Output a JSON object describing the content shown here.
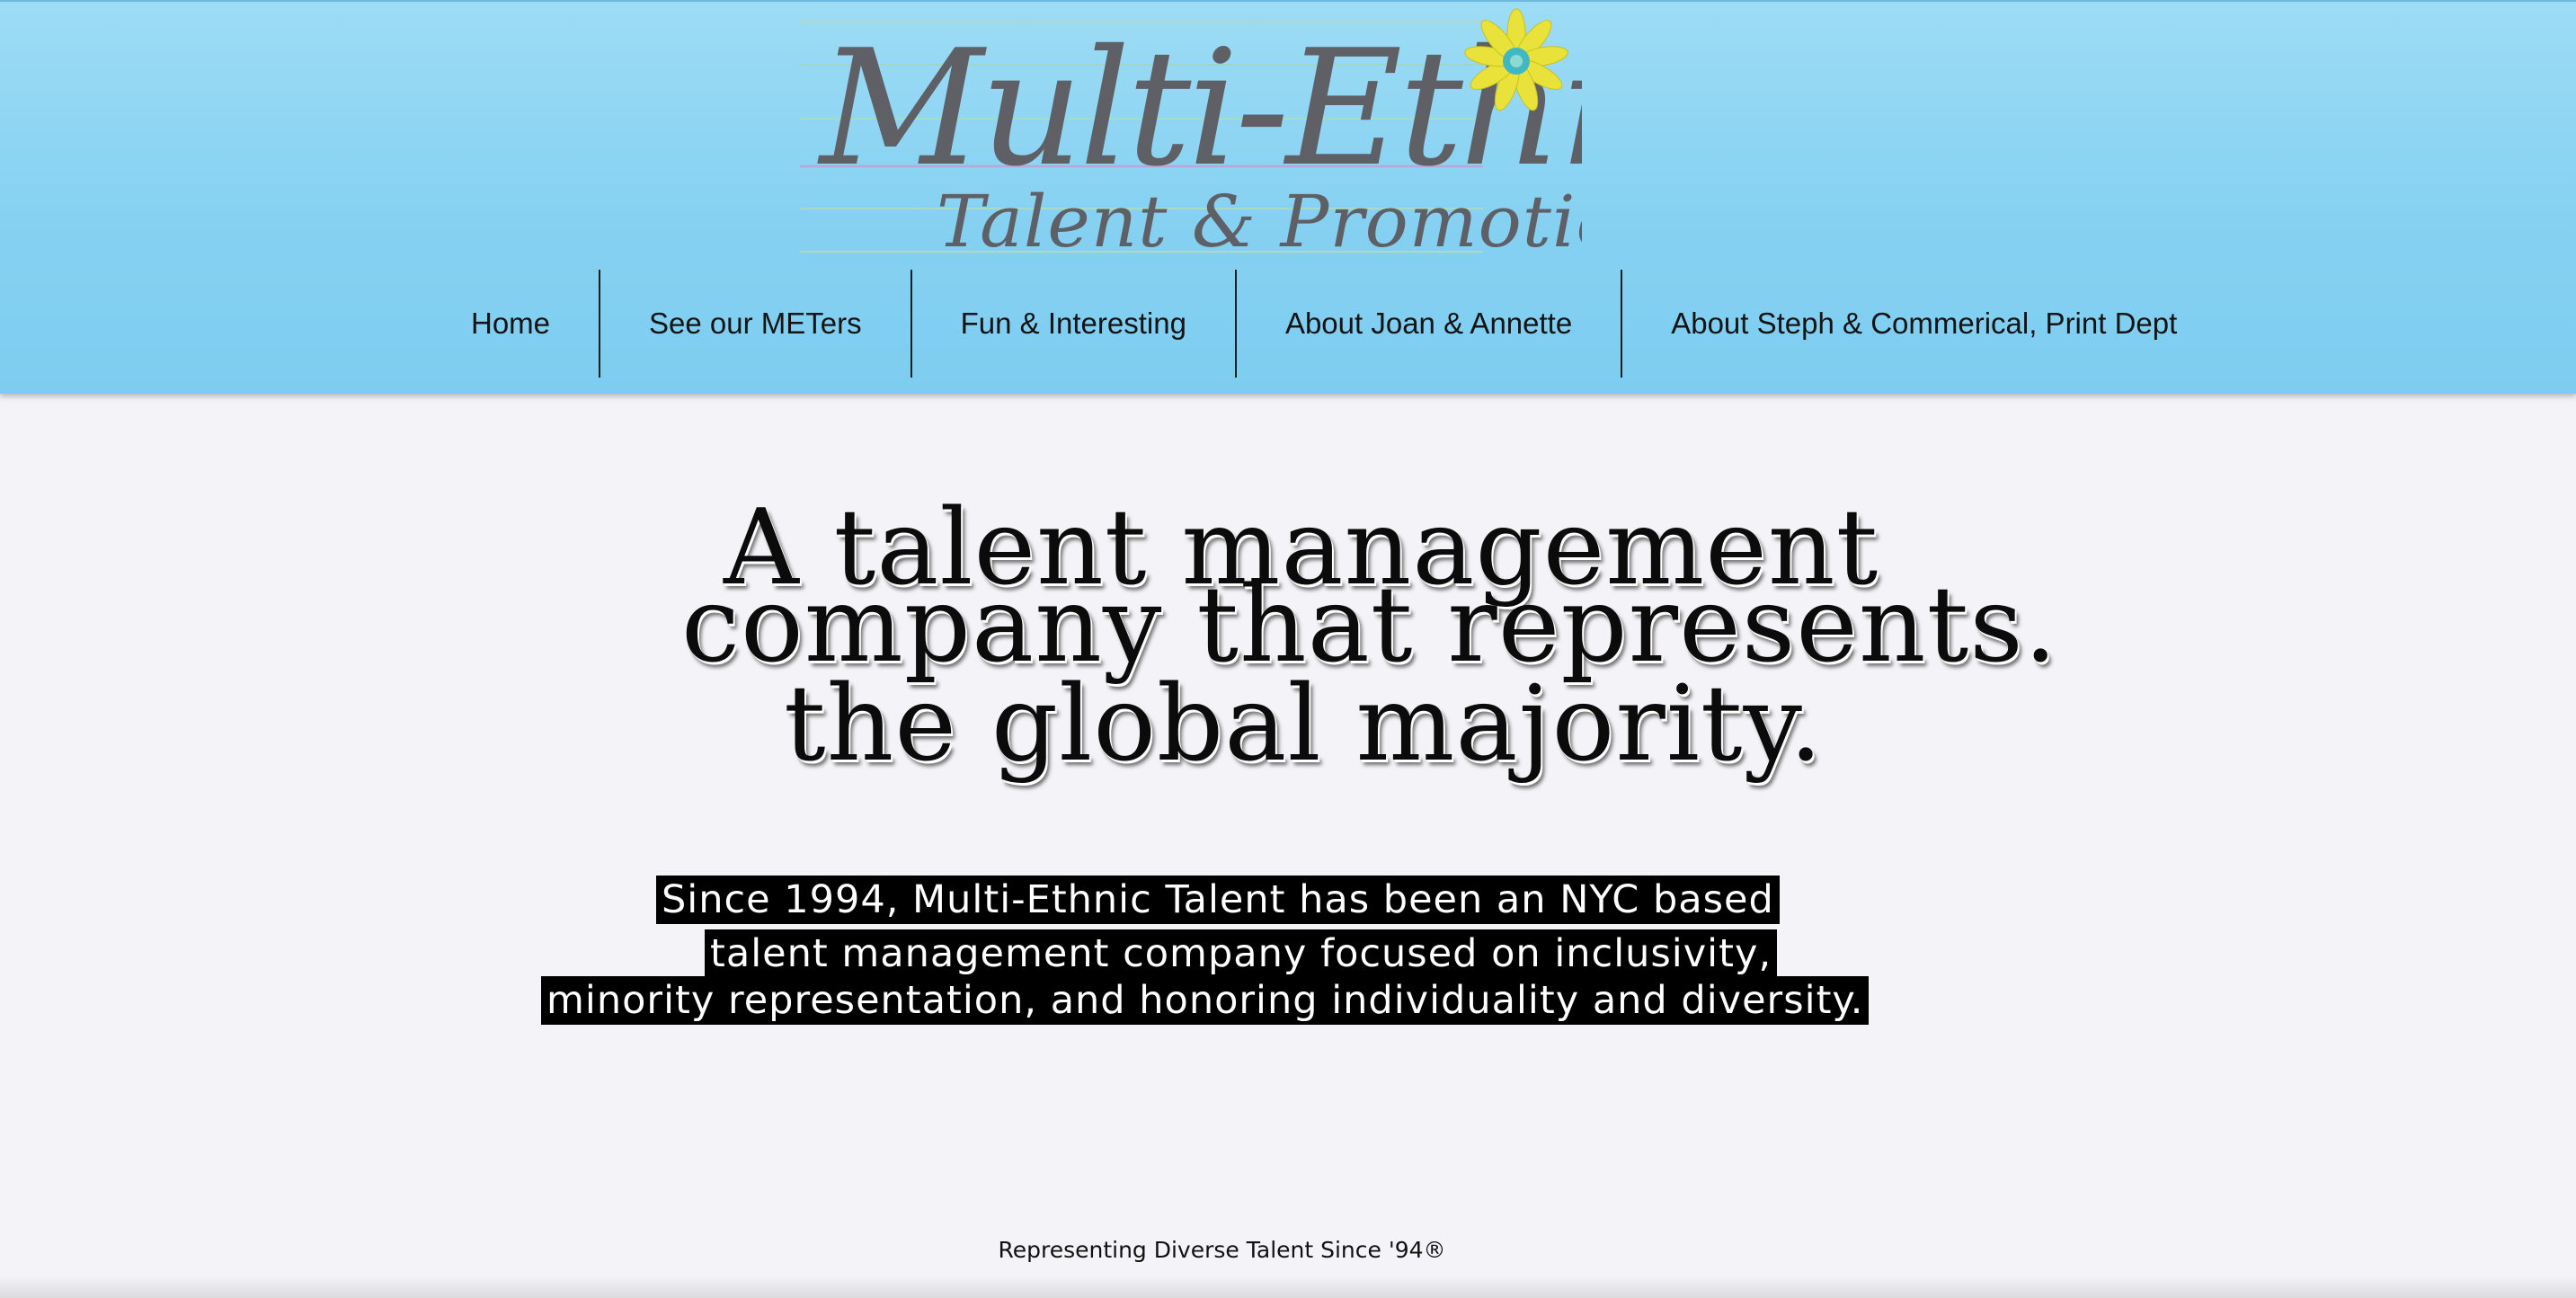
{
  "header": {
    "logo": {
      "title": "Multi-Ethnic",
      "subtitle": "Talent & Promotion",
      "flower_color": "#e8e23a",
      "flower_center_color": "#3fb8c4",
      "text_color": "#5f5f66"
    },
    "nav": [
      {
        "label": "Home"
      },
      {
        "label": "See our METers"
      },
      {
        "label": "Fun & Interesting"
      },
      {
        "label": "About Joan & Annette"
      },
      {
        "label": "About Steph & Commerical, Print Dept"
      }
    ]
  },
  "hero": {
    "lines": [
      "A talent management",
      "company that represents.",
      "the global majority."
    ]
  },
  "description": {
    "lines": [
      "Since 1994, Multi-Ethnic Talent has been an NYC based ",
      "talent management company focused on inclusivity,",
      "minority representation, and honoring individuality and diversity."
    ]
  },
  "footer": {
    "tagline": "Representing Diverse Talent Since '94®"
  },
  "colors": {
    "header_top": "#9ddcf5",
    "header_bottom": "#7dcdf0",
    "page_background": "#f4f3f7",
    "highlight_background": "#000000",
    "highlight_text": "#ffffff"
  }
}
